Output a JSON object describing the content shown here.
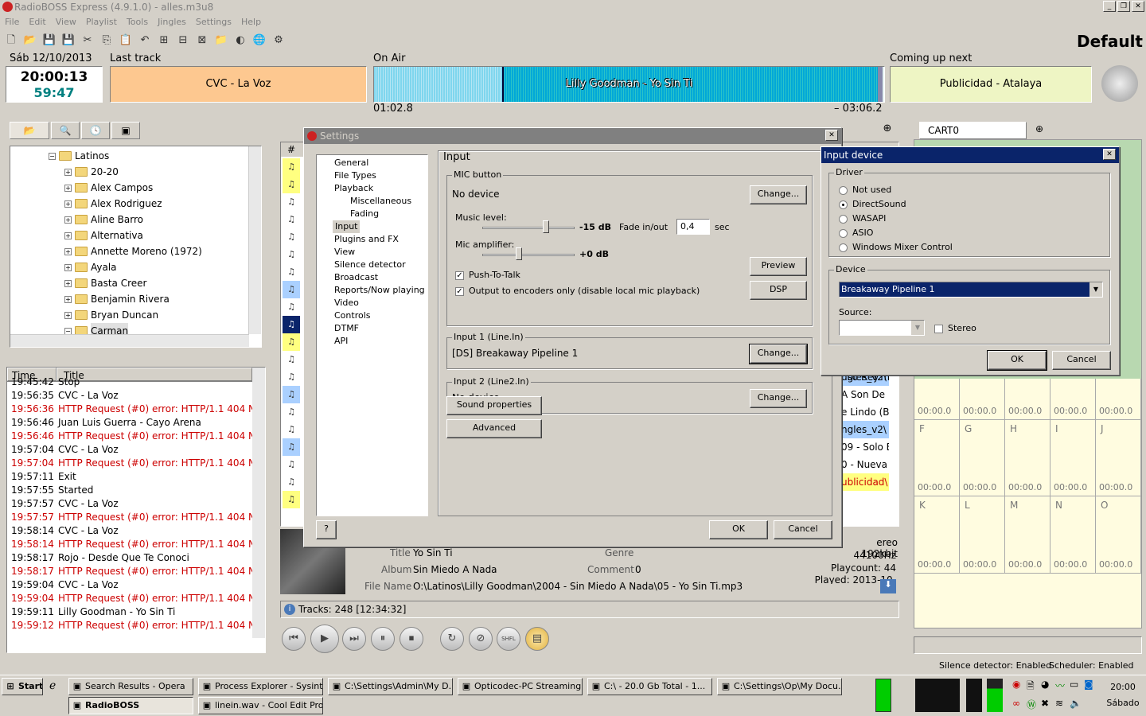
{
  "app": {
    "title": "RadioBOSS Express (4.9.1.0) - alles.m3u8",
    "profile": "Default"
  },
  "menu": [
    "File",
    "Edit",
    "View",
    "Playlist",
    "Tools",
    "Jingles",
    "Settings",
    "Help"
  ],
  "header": {
    "date": "Sáb 12/10/2013",
    "time": "20:00:13",
    "countdown": "59:47",
    "last_track_label": "Last track",
    "last_track": "CVC - La Voz",
    "on_air_label": "On Air",
    "on_air": "Lilly Goodman - Yo Sin Ti",
    "elapsed": "01:02.8",
    "remaining": "– 03:06.2",
    "next_label": "Coming up next",
    "next": "Publicidad - Atalaya"
  },
  "tree": {
    "items": [
      "Latinos",
      "20-20",
      "Alex Campos",
      "Alex Rodriguez",
      "Aline Barro",
      "Alternativa",
      "Annette Moreno (1972)",
      "Ayala",
      "Basta Creer",
      "Benjamin Rivera",
      "Bryan Duncan",
      "Carman"
    ]
  },
  "log": {
    "col_time": "Time",
    "col_title": "Title",
    "rows": [
      {
        "t": "19:45:42",
        "m": "Stop",
        "e": false
      },
      {
        "t": "19:56:35",
        "m": "CVC - La Voz",
        "e": false
      },
      {
        "t": "19:56:36",
        "m": "HTTP Request (#0) error: HTTP/1.1 404 N",
        "e": true
      },
      {
        "t": "19:56:46",
        "m": "Juan Luis Guerra - Cayo Arena",
        "e": false
      },
      {
        "t": "19:56:46",
        "m": "HTTP Request (#0) error: HTTP/1.1 404 N",
        "e": true
      },
      {
        "t": "19:57:04",
        "m": "CVC - La Voz",
        "e": false
      },
      {
        "t": "19:57:04",
        "m": "HTTP Request (#0) error: HTTP/1.1 404 N",
        "e": true
      },
      {
        "t": "19:57:11",
        "m": "Exit",
        "e": false
      },
      {
        "t": "19:57:55",
        "m": "Started",
        "e": false
      },
      {
        "t": "19:57:57",
        "m": "CVC - La Voz",
        "e": false
      },
      {
        "t": "19:57:57",
        "m": "HTTP Request (#0) error: HTTP/1.1 404 N",
        "e": true
      },
      {
        "t": "19:58:14",
        "m": "CVC - La Voz",
        "e": false
      },
      {
        "t": "19:58:14",
        "m": "HTTP Request (#0) error: HTTP/1.1 404 N",
        "e": true
      },
      {
        "t": "19:58:17",
        "m": "Rojo - Desde Que Te Conoci",
        "e": false
      },
      {
        "t": "19:58:17",
        "m": "HTTP Request (#0) error: HTTP/1.1 404 N",
        "e": true
      },
      {
        "t": "19:59:04",
        "m": "CVC - La Voz",
        "e": false
      },
      {
        "t": "19:59:04",
        "m": "HTTP Request (#0) error: HTTP/1.1 404 N",
        "e": true
      },
      {
        "t": "19:59:11",
        "m": "Lilly Goodman - Yo Sin Ti",
        "e": false
      },
      {
        "t": "19:59:12",
        "m": "HTTP Request (#0) error: HTTP/1.1 404 N",
        "e": true
      }
    ]
  },
  "playlist": {
    "col": "#",
    "right_snips": [
      "ngles_v2\\",
      "A Son De",
      "e Lindo (B",
      "ngles_v2\\",
      "09 - Solo E",
      "0 - Nueva",
      "ublicidad\\"
    ],
    "top_snip": "uso Rey.m"
  },
  "trackinfo": {
    "title_label": "Title",
    "title": "Yo Sin Ti",
    "genre_label": "Genre",
    "genre": "",
    "album_label": "Album",
    "album": "Sin Miedo A Nada",
    "comment_label": "Comment",
    "comment": "0",
    "file_label": "File Name",
    "file": "O:\\Latinos\\Lilly Goodman\\2004 - Sin Miedo A Nada\\05 - Yo Sin Ti.mp3",
    "bitrate": "ereo 192kbit",
    "rate": "44100Hz",
    "playcount": "Playcount: 44",
    "played": "Played: 2013-10-12"
  },
  "tracks": "Tracks: 248 [12:34:32]",
  "cart": {
    "tab": "CART0",
    "rows": [
      [
        "F",
        "G",
        "H",
        "I",
        "J"
      ],
      [
        "K",
        "L",
        "M",
        "N",
        "O"
      ]
    ],
    "time": "00:00.0",
    "side_snips": [
      "o",
      ".8",
      "n",
      "le",
      ".0"
    ]
  },
  "settings": {
    "title": "Settings",
    "nav": [
      "General",
      "File Types",
      "Playback",
      "Miscellaneous",
      "Fading",
      "Input",
      "Plugins and FX",
      "View",
      "Silence detector",
      "Broadcast",
      "Reports/Now playing",
      "Video",
      "Controls",
      "DTMF",
      "API"
    ],
    "section": "Input",
    "mic_group": "MIC button",
    "mic_device": "No device",
    "change": "Change...",
    "music_level": "Music level:",
    "music_db": "-15 dB",
    "fade": "Fade in/out",
    "fade_val": "0,4",
    "sec": "sec",
    "mic_amp": "Mic amplifier:",
    "mic_db": "+0 dB",
    "ptt": "Push-To-Talk",
    "output_only": "Output to encoders only (disable local mic playback)",
    "preview": "Preview",
    "dsp": "DSP",
    "in1_group": "Input 1 (Line.In)",
    "in1_device": "[DS] Breakaway Pipeline 1",
    "in2_group": "Input 2 (Line2.In)",
    "in2_device": "No device",
    "sound_props": "Sound properties",
    "advanced": "Advanced",
    "help": "?",
    "ok": "OK",
    "cancel": "Cancel"
  },
  "input_device": {
    "title": "Input device",
    "driver_group": "Driver",
    "drivers": [
      "Not used",
      "DirectSound",
      "WASAPI",
      "ASIO",
      "Windows Mixer Control"
    ],
    "selected_driver": 1,
    "device_group": "Device",
    "device": "Breakaway Pipeline 1",
    "source_label": "Source:",
    "stereo": "Stereo",
    "ok": "OK",
    "cancel": "Cancel"
  },
  "status": {
    "silence": "Silence detector: Enabled",
    "scheduler": "Scheduler: Enabled"
  },
  "taskbar": {
    "start": "Start",
    "tasks": [
      "Search Results - Opera",
      "Process Explorer - Sysint...",
      "C:\\Settings\\Admin\\My D...",
      "Opticodec-PC Streaming ...",
      "C:\\  - 20.0 Gb Total  - 1...",
      "C:\\Settings\\Op\\My Docu..."
    ],
    "tasks2": [
      "RadioBOSS",
      "linein.wav - Cool Edit Pro"
    ],
    "clock": "20:00",
    "day": "Sábado"
  },
  "colors": {
    "lasttrack": "#fdc890",
    "next": "#eef5c4",
    "cart_bg": "#fffce0",
    "error": "#cc0000",
    "dialog_title": "#808080",
    "input_title": "#0a246a"
  }
}
